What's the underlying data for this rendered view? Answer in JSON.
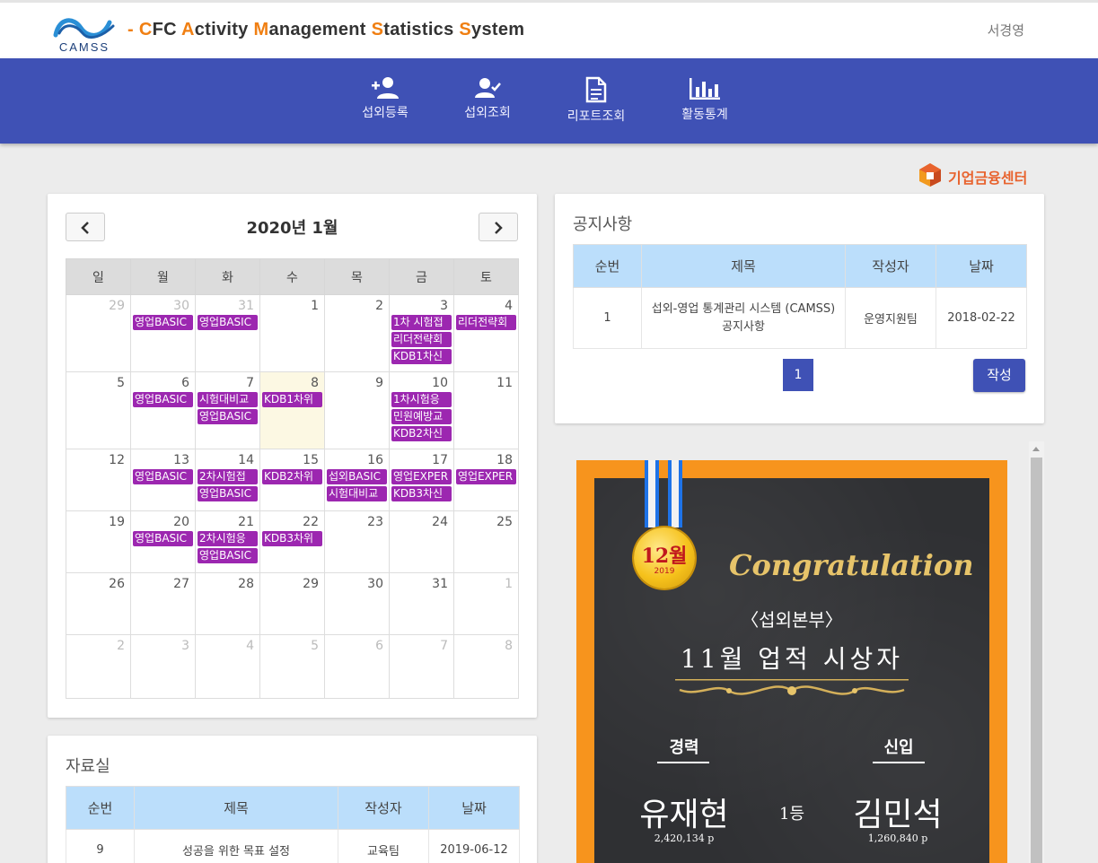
{
  "header": {
    "logo_text": "CAMSS",
    "title_parts": [
      {
        "text": "- ",
        "accent": true
      },
      {
        "text": "C",
        "accent": true
      },
      {
        "text": "FC ",
        "accent": false
      },
      {
        "text": "A",
        "accent": true
      },
      {
        "text": "ctivity ",
        "accent": false
      },
      {
        "text": "M",
        "accent": true
      },
      {
        "text": "anagement ",
        "accent": false
      },
      {
        "text": "S",
        "accent": true
      },
      {
        "text": "tatistics ",
        "accent": false
      },
      {
        "text": "S",
        "accent": true
      },
      {
        "text": "ystem",
        "accent": false
      }
    ],
    "user_name": "서경영",
    "accent_color": "#f07f12"
  },
  "nav": {
    "items": [
      {
        "label": "섭외등록",
        "icon": "person-add-icon"
      },
      {
        "label": "섭외조회",
        "icon": "person-check-icon"
      },
      {
        "label": "리포트조회",
        "icon": "document-icon"
      },
      {
        "label": "활동통계",
        "icon": "bar-chart-icon"
      }
    ],
    "color": "#3f51b5"
  },
  "brand": {
    "text": "기업금융센터",
    "color": "#e8632e"
  },
  "calendar": {
    "title": "2020년 1월",
    "prev_icon": "chevron-left-icon",
    "next_icon": "chevron-right-icon",
    "weekdays": [
      "일",
      "월",
      "화",
      "수",
      "목",
      "금",
      "토"
    ],
    "event_color": "#9c27b0",
    "weeks": [
      [
        {
          "day": "29",
          "other": true,
          "events": []
        },
        {
          "day": "30",
          "other": true,
          "events": [
            "영업BASIC"
          ]
        },
        {
          "day": "31",
          "other": true,
          "events": [
            "영업BASIC"
          ]
        },
        {
          "day": "1",
          "events": []
        },
        {
          "day": "2",
          "events": []
        },
        {
          "day": "3",
          "events": [
            "1차 시험접",
            "리더전략회",
            "KDB1차신"
          ]
        },
        {
          "day": "4",
          "events": [
            "리더전략회"
          ]
        }
      ],
      [
        {
          "day": "5",
          "events": []
        },
        {
          "day": "6",
          "events": [
            "영업BASIC"
          ]
        },
        {
          "day": "7",
          "events": [
            "시험대비교",
            "영업BASIC"
          ]
        },
        {
          "day": "8",
          "today": true,
          "events": [
            "KDB1차위"
          ]
        },
        {
          "day": "9",
          "events": []
        },
        {
          "day": "10",
          "events": [
            "1차시험응",
            "민원예방교",
            "KDB2차신"
          ]
        },
        {
          "day": "11",
          "events": []
        }
      ],
      [
        {
          "day": "12",
          "events": []
        },
        {
          "day": "13",
          "events": [
            "영업BASIC"
          ]
        },
        {
          "day": "14",
          "events": [
            "2차시험접",
            "영업BASIC"
          ]
        },
        {
          "day": "15",
          "events": [
            "KDB2차위"
          ]
        },
        {
          "day": "16",
          "events": [
            "섭외BASIC",
            "시험대비교"
          ]
        },
        {
          "day": "17",
          "events": [
            "영업EXPER",
            "KDB3차신"
          ]
        },
        {
          "day": "18",
          "events": [
            "영업EXPER"
          ]
        }
      ],
      [
        {
          "day": "19",
          "events": []
        },
        {
          "day": "20",
          "events": [
            "영업BASIC"
          ]
        },
        {
          "day": "21",
          "events": [
            "2차시험응",
            "영업BASIC"
          ]
        },
        {
          "day": "22",
          "events": [
            "KDB3차위"
          ]
        },
        {
          "day": "23",
          "events": []
        },
        {
          "day": "24",
          "events": []
        },
        {
          "day": "25",
          "events": []
        }
      ],
      [
        {
          "day": "26",
          "events": []
        },
        {
          "day": "27",
          "events": []
        },
        {
          "day": "28",
          "events": []
        },
        {
          "day": "29",
          "events": []
        },
        {
          "day": "30",
          "events": []
        },
        {
          "day": "31",
          "events": []
        },
        {
          "day": "1",
          "other": true,
          "events": []
        }
      ],
      [
        {
          "day": "2",
          "other": true,
          "events": []
        },
        {
          "day": "3",
          "other": true,
          "events": []
        },
        {
          "day": "4",
          "other": true,
          "events": []
        },
        {
          "day": "5",
          "other": true,
          "events": []
        },
        {
          "day": "6",
          "other": true,
          "events": []
        },
        {
          "day": "7",
          "other": true,
          "events": []
        },
        {
          "day": "8",
          "other": true,
          "events": []
        }
      ]
    ]
  },
  "notice": {
    "heading": "공지사항",
    "columns": [
      "순번",
      "제목",
      "작성자",
      "날짜"
    ],
    "rows": [
      [
        "1",
        "섭외-영업 통계관리 시스템 (CAMSS) 공지사항",
        "운영지원팀",
        "2018-02-22"
      ]
    ],
    "page": "1",
    "write_label": "작성"
  },
  "files": {
    "heading": "자료실",
    "columns": [
      "순번",
      "제목",
      "작성자",
      "날짜"
    ],
    "rows": [
      [
        "9",
        "성공을 위한 목표 설정",
        "교육팀",
        "2019-06-12"
      ]
    ]
  },
  "award": {
    "medal_month": "12월",
    "medal_year": "2019",
    "congrats": "Congratulation",
    "dept": "〈섭외본부〉",
    "title": "11월 업적 시상자",
    "left_category": "경력",
    "right_category": "신입",
    "left_winner": "유재현",
    "right_winner": "김민석",
    "rank": "1등",
    "left_points": "2,420,134 p",
    "right_points": "1,260,840 p"
  }
}
